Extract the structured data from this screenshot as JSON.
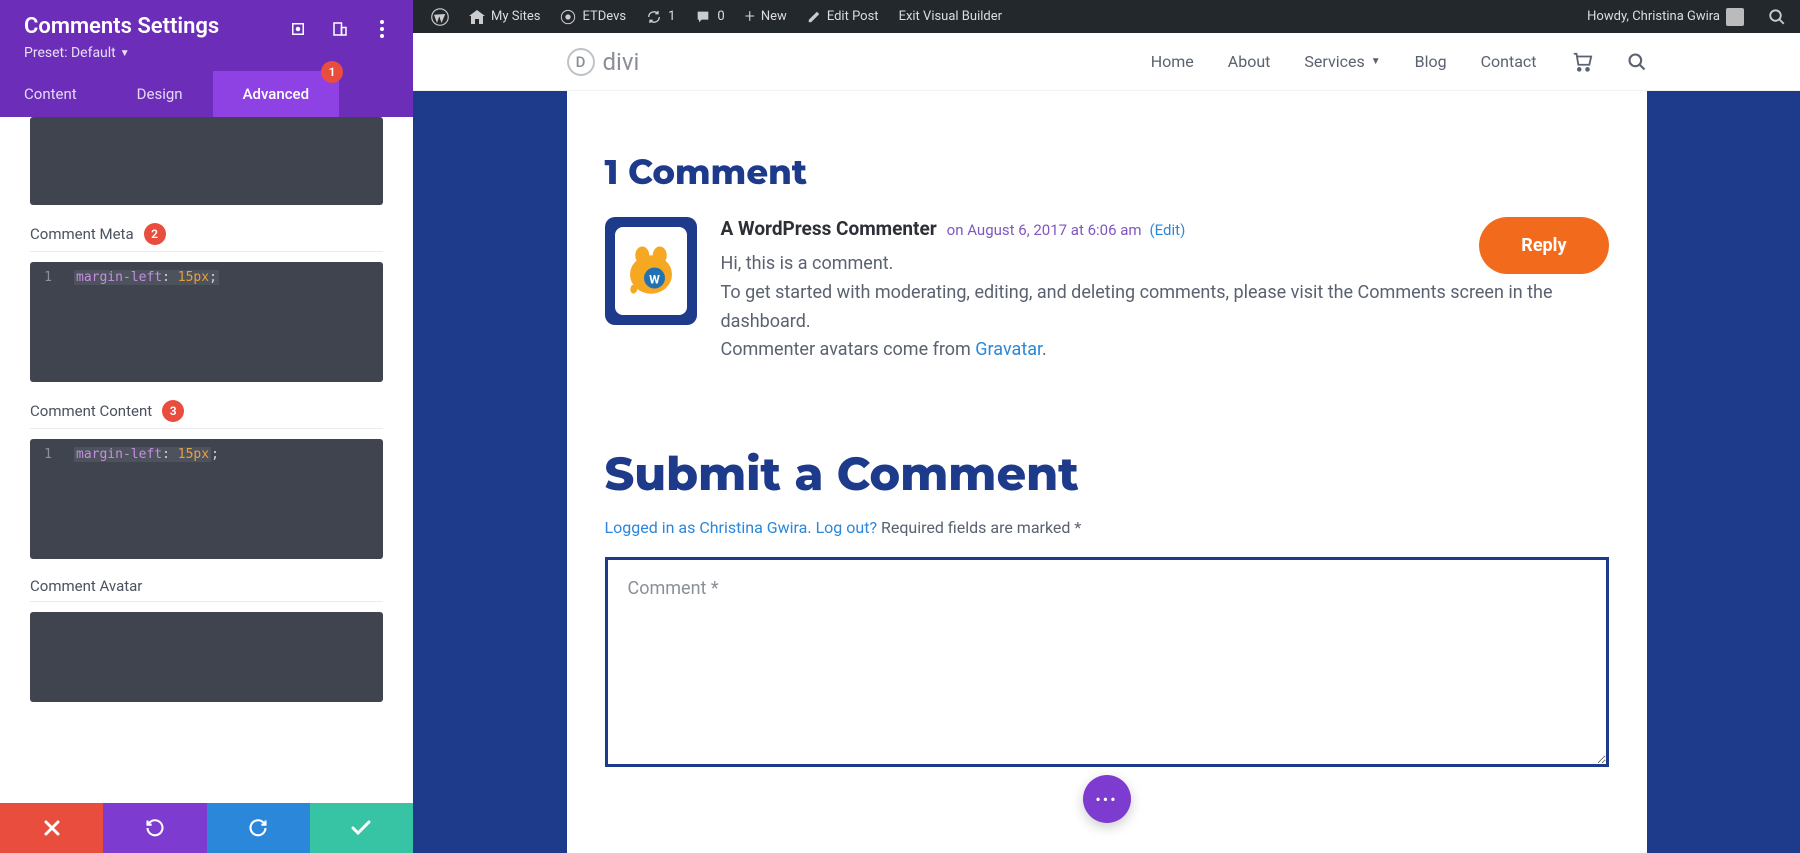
{
  "sidebar": {
    "title": "Comments Settings",
    "preset_label": "Preset: Default",
    "tabs": {
      "content": "Content",
      "design": "Design",
      "advanced": "Advanced",
      "advanced_badge": "1"
    },
    "sections": {
      "meta": {
        "label": "Comment Meta",
        "badge": "2",
        "code": {
          "line": "1",
          "prop": "margin-left",
          "val": "15px"
        }
      },
      "content": {
        "label": "Comment Content",
        "badge": "3",
        "code": {
          "line": "1",
          "prop": "margin-left",
          "val": "15px"
        }
      },
      "avatar": {
        "label": "Comment Avatar"
      }
    }
  },
  "wpbar": {
    "my_sites": "My Sites",
    "site_name": "ETDevs",
    "updates_count": "1",
    "comments_count": "0",
    "new": "New",
    "edit_post": "Edit Post",
    "exit_builder": "Exit Visual Builder",
    "howdy": "Howdy, Christina Gwira"
  },
  "site": {
    "logo_letter": "D",
    "logo_text": "divi",
    "nav": {
      "home": "Home",
      "about": "About",
      "services": "Services",
      "blog": "Blog",
      "contact": "Contact"
    }
  },
  "page": {
    "comments_heading": "1 Comment",
    "comment": {
      "author": "A WordPress Commenter",
      "meta": "on August 6, 2017 at 6:06 am",
      "edit": "(Edit)",
      "line1": "Hi, this is a comment.",
      "line2": "To get started with moderating, editing, and deleting comments, please visit the Comments screen in the dashboard.",
      "line3a": "Commenter avatars come from ",
      "gravatar": "Gravatar",
      "line3b": ".",
      "reply": "Reply"
    },
    "submit_heading": "Submit a Comment",
    "logged_in": "Logged in as Christina Gwira",
    "logout": "Log out?",
    "required": "Required fields are marked *",
    "placeholder": "Comment *"
  }
}
